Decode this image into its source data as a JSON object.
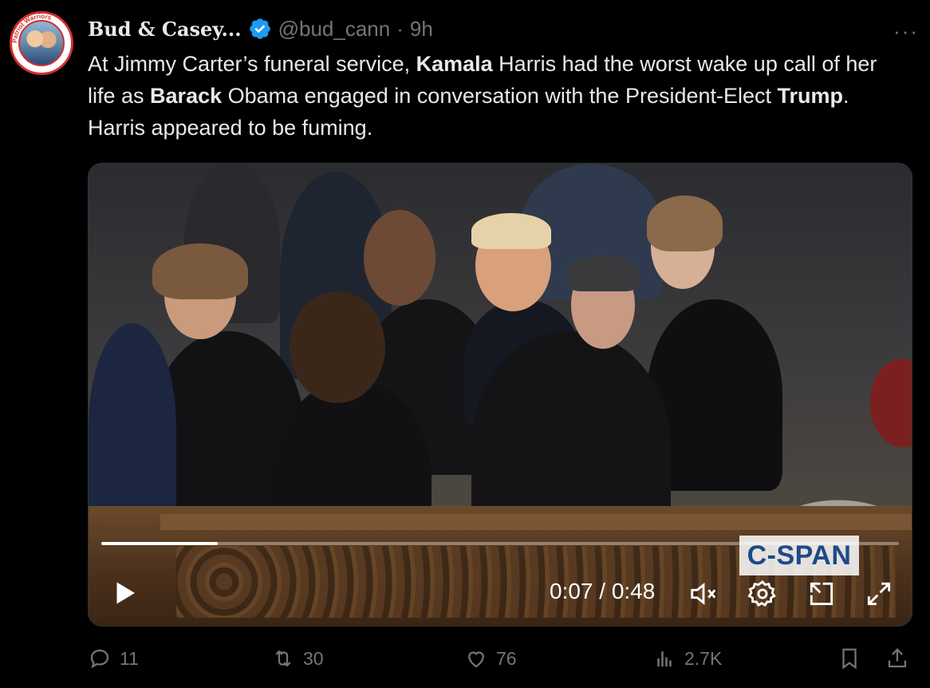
{
  "author": {
    "display_name": "Bud & Casey...",
    "handle": "@bud_cann",
    "separator": "·",
    "time_ago": "9h",
    "verified": true,
    "avatar_ring_text": "Patriot Warriors"
  },
  "more_label": "···",
  "tweet": {
    "segments": [
      {
        "text": "At Jimmy Carter’s funeral service, ",
        "bold": false
      },
      {
        "text": "Kamala",
        "bold": true
      },
      {
        "text": " Harris had the worst wake up call of her life as ",
        "bold": false
      },
      {
        "text": "Barack",
        "bold": true
      },
      {
        "text": " Obama engaged in conversation with the President-Elect ",
        "bold": false
      },
      {
        "text": "Trump",
        "bold": true
      },
      {
        "text": ". Harris appeared to be fuming.",
        "bold": false
      }
    ]
  },
  "video": {
    "watermark": "C-SPAN",
    "current_time": "0:07",
    "duration": "0:48",
    "time_display": "0:07 / 0:48",
    "progress_fraction": 0.146,
    "controls": [
      "play-icon",
      "mute-icon",
      "settings-icon",
      "pip-icon",
      "fullscreen-icon"
    ]
  },
  "actions": {
    "replies": "11",
    "reposts": "30",
    "likes": "76",
    "views": "2.7K"
  },
  "colors": {
    "background": "#000000",
    "text": "#e7e9ea",
    "muted": "#71767b",
    "verified": "#1d9bf0",
    "cspan_blue": "#1c4a8a"
  }
}
